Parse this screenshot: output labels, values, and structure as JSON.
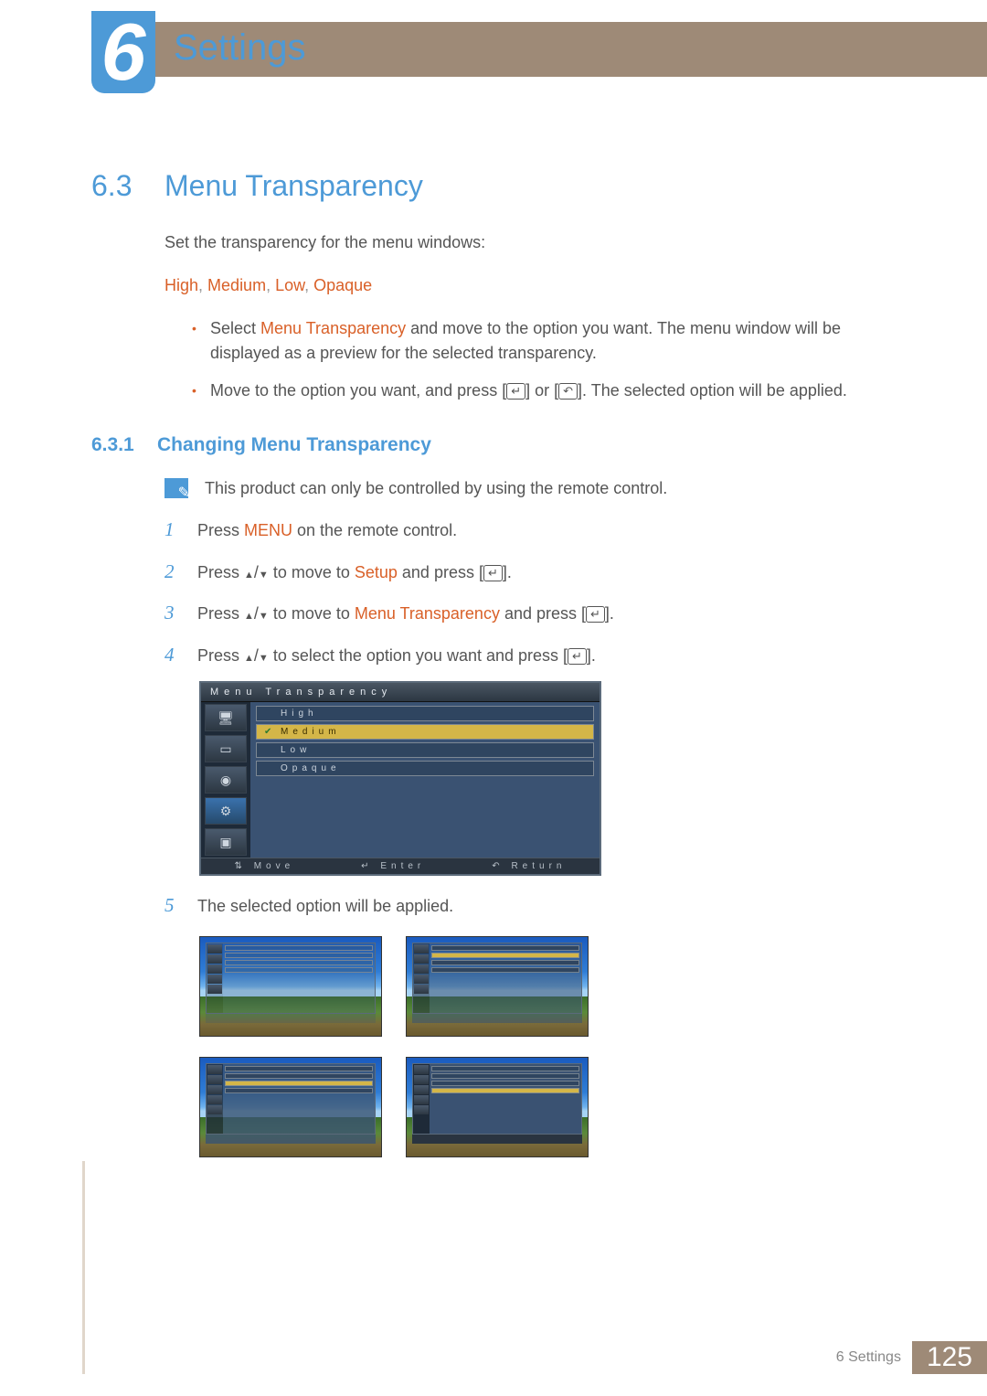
{
  "chapter": {
    "number": "6",
    "title": "Settings"
  },
  "section": {
    "number": "6.3",
    "title": "Menu Transparency"
  },
  "intro": "Set the transparency for the menu windows:",
  "options_line": {
    "o1": "High",
    "o2": "Medium",
    "o3": "Low",
    "o4": "Opaque",
    "sep": ", "
  },
  "bullets": {
    "b1a": "Select ",
    "b1hl": "Menu Transparency",
    "b1b": " and move to the option you want. The menu window will be displayed as a preview for the selected transparency.",
    "b2a": "Move to the option you want, and press [",
    "b2b": "] or [",
    "b2c": "]. The selected option will be applied."
  },
  "subsection": {
    "number": "6.3.1",
    "title": "Changing Menu Transparency"
  },
  "note": "This product can only be controlled by using the remote control.",
  "steps": {
    "s1": {
      "n": "1",
      "a": "Press ",
      "hl": "MENU",
      "b": " on the remote control."
    },
    "s2": {
      "n": "2",
      "a": "Press ",
      "b": " to move to ",
      "hl": "Setup",
      "c": " and press [",
      "d": "]."
    },
    "s3": {
      "n": "3",
      "a": "Press ",
      "b": " to move to ",
      "hl": "Menu Transparency",
      "c": " and press [",
      "d": "]."
    },
    "s4": {
      "n": "4",
      "a": "Press ",
      "b": " to select the option you want and press [",
      "c": "]."
    },
    "s5": {
      "n": "5",
      "a": "The selected option will be applied."
    }
  },
  "osd": {
    "title": "Menu Transparency",
    "opts": {
      "o1": "High",
      "o2": "Medium",
      "o3": "Low",
      "o4": "Opaque"
    },
    "footer": {
      "f1": "Move",
      "f2": "Enter",
      "f3": "Return"
    }
  },
  "footer": {
    "label": "6 Settings",
    "page": "125"
  }
}
